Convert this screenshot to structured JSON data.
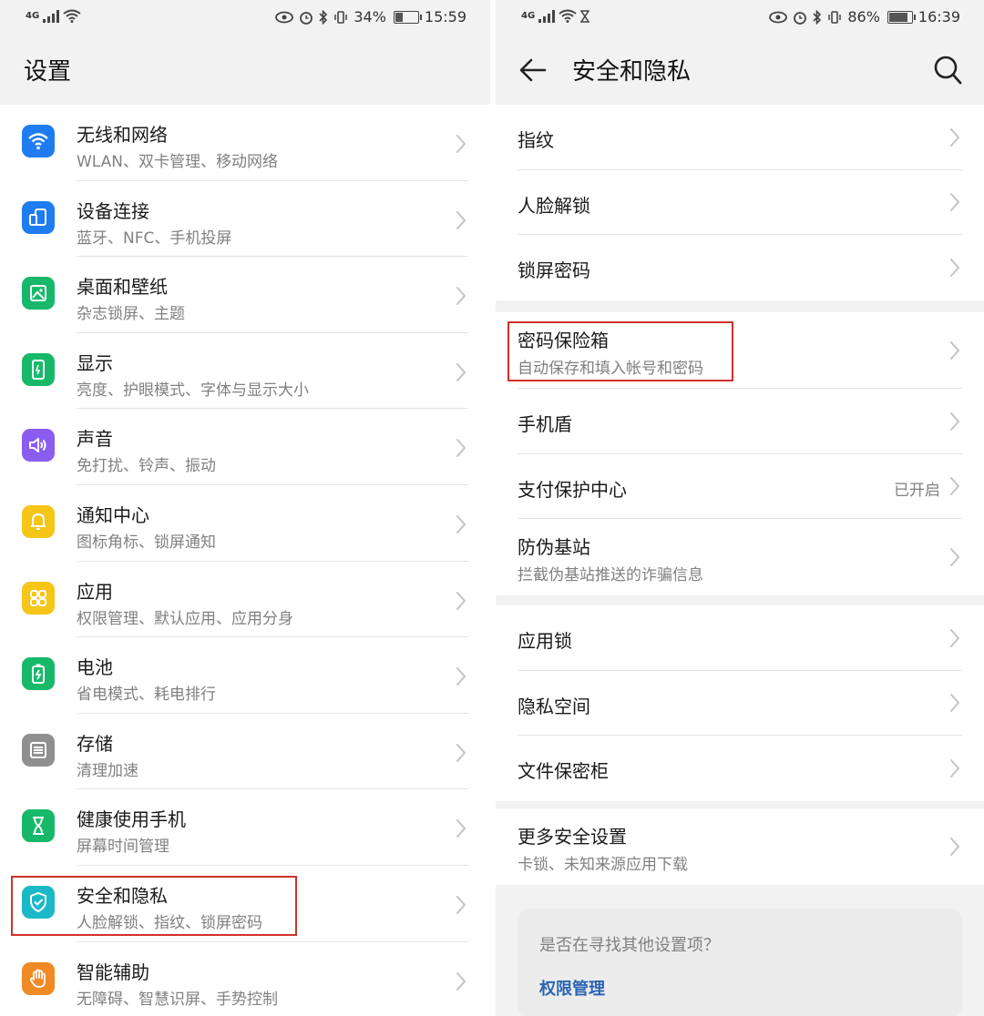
{
  "left_screen": {
    "status_bar": {
      "network": "4G",
      "battery_percent": "34%",
      "time": "15:59"
    },
    "title": "设置",
    "items": [
      {
        "icon": "wifi-icon",
        "color": "#1e7cf0",
        "title": "无线和网络",
        "subtitle": "WLAN、双卡管理、移动网络"
      },
      {
        "icon": "device-connect-icon",
        "color": "#1e7cf0",
        "title": "设备连接",
        "subtitle": "蓝牙、NFC、手机投屏"
      },
      {
        "icon": "wallpaper-icon",
        "color": "#17b86a",
        "title": "桌面和壁纸",
        "subtitle": "杂志锁屏、主题"
      },
      {
        "icon": "display-icon",
        "color": "#17b86a",
        "title": "显示",
        "subtitle": "亮度、护眼模式、字体与显示大小"
      },
      {
        "icon": "sound-icon",
        "color": "#8a5cf0",
        "title": "声音",
        "subtitle": "免打扰、铃声、振动"
      },
      {
        "icon": "bell-icon",
        "color": "#f5c518",
        "title": "通知中心",
        "subtitle": "图标角标、锁屏通知"
      },
      {
        "icon": "apps-icon",
        "color": "#f5c518",
        "title": "应用",
        "subtitle": "权限管理、默认应用、应用分身"
      },
      {
        "icon": "battery-icon",
        "color": "#17b86a",
        "title": "电池",
        "subtitle": "省电模式、耗电排行"
      },
      {
        "icon": "storage-icon",
        "color": "#8f8f8f",
        "title": "存储",
        "subtitle": "清理加速"
      },
      {
        "icon": "hourglass-icon",
        "color": "#17b86a",
        "title": "健康使用手机",
        "subtitle": "屏幕时间管理"
      },
      {
        "icon": "shield-icon",
        "color": "#1bb9c7",
        "title": "安全和隐私",
        "subtitle": "人脸解锁、指纹、锁屏密码"
      },
      {
        "icon": "hand-icon",
        "color": "#f08a24",
        "title": "智能辅助",
        "subtitle": "无障碍、智慧识屏、手势控制"
      }
    ]
  },
  "right_screen": {
    "status_bar": {
      "network": "4G",
      "battery_percent": "86%",
      "time": "16:39"
    },
    "title": "安全和隐私",
    "groups": [
      {
        "items": [
          {
            "title": "指纹",
            "subtitle": ""
          },
          {
            "title": "人脸解锁",
            "subtitle": ""
          },
          {
            "title": "锁屏密码",
            "subtitle": ""
          }
        ]
      },
      {
        "items": [
          {
            "title": "密码保险箱",
            "subtitle": "自动保存和填入帐号和密码"
          },
          {
            "title": "手机盾",
            "subtitle": ""
          },
          {
            "title": "支付保护中心",
            "subtitle": "",
            "value": "已开启"
          },
          {
            "title": "防伪基站",
            "subtitle": "拦截伪基站推送的诈骗信息"
          }
        ]
      },
      {
        "items": [
          {
            "title": "应用锁",
            "subtitle": ""
          },
          {
            "title": "隐私空间",
            "subtitle": ""
          },
          {
            "title": "文件保密柜",
            "subtitle": ""
          }
        ]
      },
      {
        "items": [
          {
            "title": "更多安全设置",
            "subtitle": "卡锁、未知来源应用下载"
          }
        ]
      }
    ],
    "tip": {
      "question": "是否在寻找其他设置项？",
      "link": "权限管理"
    }
  },
  "colors": {
    "highlight_box": "#d0312d",
    "link": "#2a64b4"
  }
}
